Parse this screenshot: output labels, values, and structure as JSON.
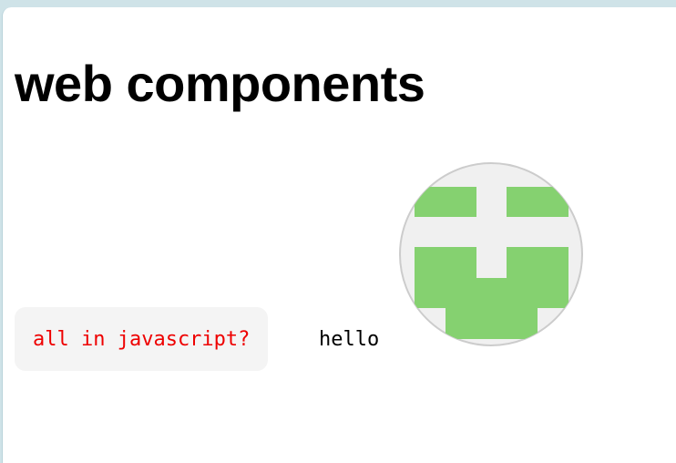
{
  "page": {
    "title": "web components"
  },
  "content": {
    "code_chip_text": "all in javascript?",
    "hello_text": "hello"
  },
  "avatar": {
    "icon": "identicon-avatar-icon",
    "fill_color": "#85d170",
    "background_color": "#f0f0f0",
    "border_color": "#cccccc"
  }
}
